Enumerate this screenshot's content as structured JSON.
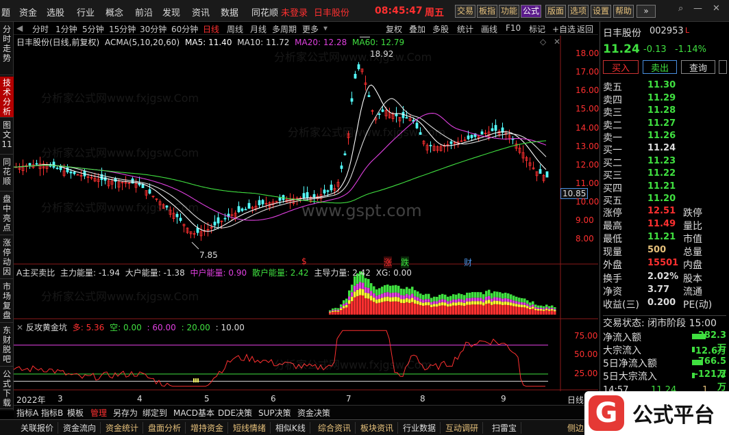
{
  "menu": [
    "题",
    "资金",
    "选股",
    "行业",
    "概念",
    "前沿",
    "发现",
    "资讯",
    "数据",
    "同花顺"
  ],
  "login_status": "未登录",
  "stock_name": "日丰股份",
  "clock": "08:45:47",
  "weekday": "周五",
  "top_buttons": [
    "交易",
    "板指",
    "功能",
    "公式",
    "版面",
    "选项",
    "设置",
    "帮助"
  ],
  "left_tabs": [
    "分时走势",
    "技术分析",
    "图文11",
    "同花顺",
    "盘中亮点",
    "涨停动因",
    "市场复盘",
    "东财脱吧",
    "公式下载"
  ],
  "periods": [
    "分时",
    "1分钟",
    "5分钟",
    "15分钟",
    "30分钟",
    "60分钟",
    "日线",
    "周线",
    "月线",
    "多周期",
    "更多"
  ],
  "right_tools": [
    "复权",
    "叠加",
    "多股",
    "统计",
    "画线",
    "F10",
    "标记",
    "+自选",
    "返回"
  ],
  "chart_header": {
    "title": "日丰股份(日线,前复权)",
    "indicator": "ACMA(5,10,20,60)",
    "ma5": "MA5: 11.40",
    "ma10": "MA10: 11.72",
    "ma20": "MA20: 12.28",
    "ma60": "MA60: 12.79"
  },
  "annotations": {
    "high": "18.92",
    "low": "7.85",
    "last_price_tag": "10.85"
  },
  "event_marks": [
    "$",
    "涨",
    "跌",
    "财"
  ],
  "sub1": {
    "title": "A主买卖比",
    "a": "主力能量: -1.94",
    "b": "大户能量: -1.38",
    "c": "中户能量: 0.90",
    "d": "散户能量: 2.42",
    "e": "主导力量: 2.42",
    "f": "XG: 0.00"
  },
  "sub2": {
    "title": "反攻黄金坑",
    "duo": "多: 5.36",
    "kong": "空: 0.00",
    "l1": ": 60.00",
    "l2": ": 20.00",
    "l3": ": 10.00"
  },
  "xaxis": [
    "2022年",
    "3",
    "4",
    "5",
    "6",
    "7",
    "8",
    "9"
  ],
  "price_ticks": [
    "18.00",
    "17.00",
    "16.00",
    "15.00",
    "14.00",
    "13.00",
    "12.00",
    "11.00",
    "10.00",
    "9.00",
    "8.00"
  ],
  "osc_ticks": [
    "75.00",
    "50.00",
    "25.00"
  ],
  "rp": {
    "name": "日丰股份",
    "code": "002953",
    "price": "11.24",
    "change": "-0.13",
    "pct": "-1.14%",
    "btns": [
      "买入",
      "卖出",
      "查询"
    ],
    "asks": [
      [
        "卖五",
        "11.30"
      ],
      [
        "卖四",
        "11.29"
      ],
      [
        "卖三",
        "11.28"
      ],
      [
        "卖二",
        "11.27"
      ],
      [
        "卖一",
        "11.26"
      ]
    ],
    "bids": [
      [
        "买一",
        "11.24"
      ],
      [
        "买二",
        "11.23"
      ],
      [
        "买三",
        "11.22"
      ],
      [
        "买四",
        "11.21"
      ],
      [
        "买五",
        "11.20"
      ]
    ],
    "stats": [
      [
        "涨停",
        "12.51",
        "跌停"
      ],
      [
        "最高",
        "11.49",
        "量比"
      ],
      [
        "最低",
        "11.21",
        "市值"
      ],
      [
        "现量",
        "500",
        "总量"
      ],
      [
        "外盘",
        "15501",
        "内盘"
      ]
    ],
    "stats2": [
      [
        "换手",
        "2.02%",
        "股本"
      ],
      [
        "净资",
        "3.77",
        "流通"
      ],
      [
        "收益(三)",
        "0.200",
        "PE(动)"
      ]
    ],
    "trade_status": "交易状态: 闭市阶段 15:00",
    "flows": [
      [
        "净流入额",
        "-282.3万"
      ],
      [
        "大宗流入",
        "-12.6万"
      ],
      [
        "5日净流入额",
        "-766.5万"
      ],
      [
        "5日大宗流入",
        "-121.2万"
      ]
    ],
    "tick_time": "14:57",
    "tick_price": "11.24",
    "tick_vol": "1"
  },
  "tabs1": [
    "指标A",
    "指标B",
    "模板",
    "管理",
    "另存为",
    "绑定到",
    "MACD基本",
    "DDE决策",
    "SUP决策",
    "资金决策"
  ],
  "tabs2": [
    "关联报价",
    "资金流向",
    "资金统计",
    "盘面分析",
    "增持资金",
    "短线情绪",
    "相似K线",
    "综合资讯",
    "板块资讯",
    "行业数据",
    "互动调研",
    "扫雷宝",
    "侧边"
  ],
  "day_label": "日线",
  "watermark": "分析家公式网www.fxjgsw.Com",
  "watermark2": "www.gspt.com",
  "logo": "公式平台",
  "chart_data": {
    "type": "line",
    "title": "日丰股份(日线,前复权)",
    "x": [
      "2022-02",
      "2022-03",
      "2022-04",
      "2022-05",
      "2022-06",
      "2022-07",
      "2022-08",
      "2022-09"
    ],
    "series": [
      {
        "name": "MA5",
        "values": [
          12.0,
          11.8,
          11.2,
          8.3,
          9.8,
          16.5,
          13.5,
          11.4
        ]
      },
      {
        "name": "MA20",
        "values": [
          12.1,
          12.0,
          11.6,
          9.0,
          9.9,
          14.8,
          13.7,
          12.28
        ]
      },
      {
        "name": "MA60",
        "values": [
          12.3,
          12.2,
          11.9,
          10.3,
          10.2,
          12.0,
          13.4,
          12.79
        ]
      }
    ],
    "high": 18.92,
    "low": 7.85,
    "ylim": [
      7.5,
      19
    ]
  }
}
